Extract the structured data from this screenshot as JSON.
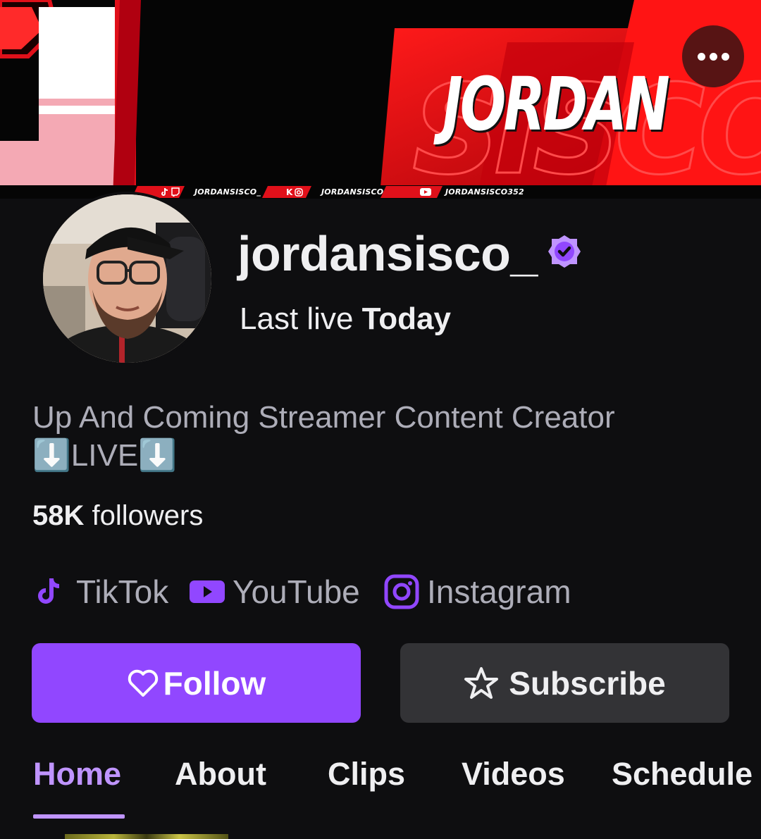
{
  "banner": {
    "name_text": "JORDAN",
    "handles": [
      "JORDANSISCO_",
      "JORDANSISCO",
      "JORDANSISCO352"
    ]
  },
  "profile": {
    "username": "jordansisco_",
    "last_live_label": "Last live",
    "last_live_value": "Today",
    "bio": "Up And Coming Streamer  Content Creator\n⬇️LIVE⬇️",
    "followers_count": "58K",
    "followers_label": "followers"
  },
  "socials": [
    {
      "label": "TikTok",
      "icon": "tiktok-icon"
    },
    {
      "label": "YouTube",
      "icon": "youtube-icon"
    },
    {
      "label": "Instagram",
      "icon": "instagram-icon"
    }
  ],
  "actions": {
    "follow_label": "Follow",
    "subscribe_label": "Subscribe"
  },
  "tabs": [
    {
      "label": "Home",
      "active": true
    },
    {
      "label": "About",
      "active": false
    },
    {
      "label": "Clips",
      "active": false
    },
    {
      "label": "Videos",
      "active": false
    },
    {
      "label": "Schedule",
      "active": false
    }
  ],
  "colors": {
    "accent": "#9147ff",
    "accent_light": "#bf94ff",
    "background": "#0e0e10",
    "muted_text": "#adadb8",
    "banner_red": "#e0101a"
  }
}
